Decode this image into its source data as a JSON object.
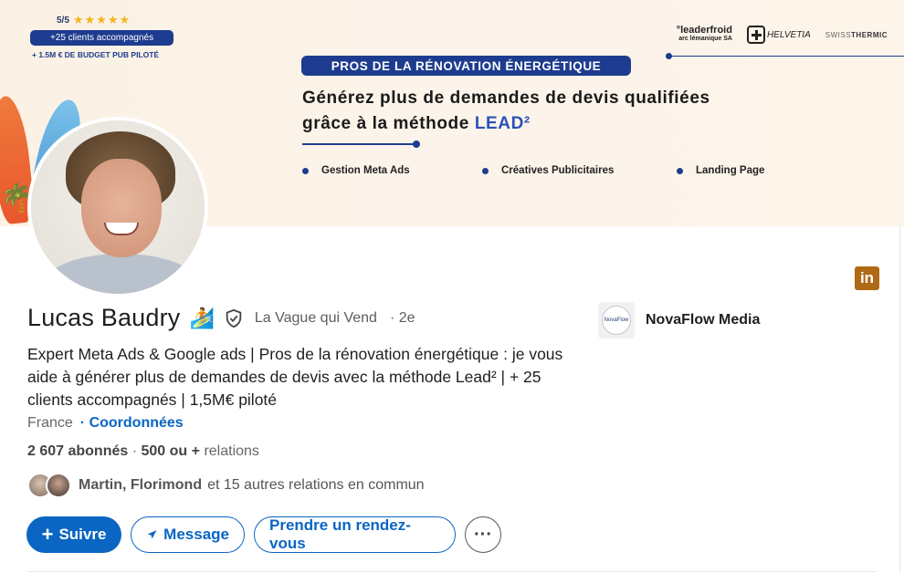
{
  "banner": {
    "rating": "5/5",
    "stars": "★★★★★",
    "clients_pill": "+25 clients accompagnés",
    "budget": "+ 1.5M € DE BUDGET PUB PILOTÉ",
    "brands": {
      "leaderfroid_main": "°leaderfroid",
      "leaderfroid_sub": "arc lémanique SA",
      "helvetia": "HELVETIA",
      "swiss_a": "SWISS",
      "swiss_b": "THERMIC"
    },
    "pill_title": "PROS DE LA RÉNOVATION ÉNERGÉTIQUE",
    "headline_line1": "Générez plus de demandes de devis qualifiées",
    "headline_line2_prefix": "grâce à la méthode ",
    "headline_accent": "LEAD²",
    "bullets": [
      "Gestion Meta Ads",
      "Créatives Publicitaires",
      "Landing Page"
    ]
  },
  "profile": {
    "name": "Lucas Baudry",
    "emoji": "🏄",
    "organization": "La Vague qui Vend",
    "degree": "· 2e",
    "headline": "Expert Meta Ads & Google ads | Pros de la rénovation énergétique : je vous aide à générer plus de demandes de devis avec la méthode Lead² | + 25 clients accompagnés | 1,5M€ piloté",
    "location": "France",
    "contact_label": "· Coordonnées",
    "followers": "2 607 abonnés",
    "relations_count": "500 ou +",
    "relations_label": "relations",
    "mutual_names": "Martin, Florimond",
    "mutual_rest": "et 15 autres relations en commun"
  },
  "company": {
    "name": "NovaFlow Media",
    "logo_text": "NovaFlow"
  },
  "linkedin_badge": "in",
  "actions": {
    "follow": "Suivre",
    "message": "Message",
    "appointment": "Prendre un rendez-vous",
    "more": "···"
  },
  "colors": {
    "brand_blue": "#1e3c8f",
    "linkedin_blue": "#0a66c2"
  }
}
